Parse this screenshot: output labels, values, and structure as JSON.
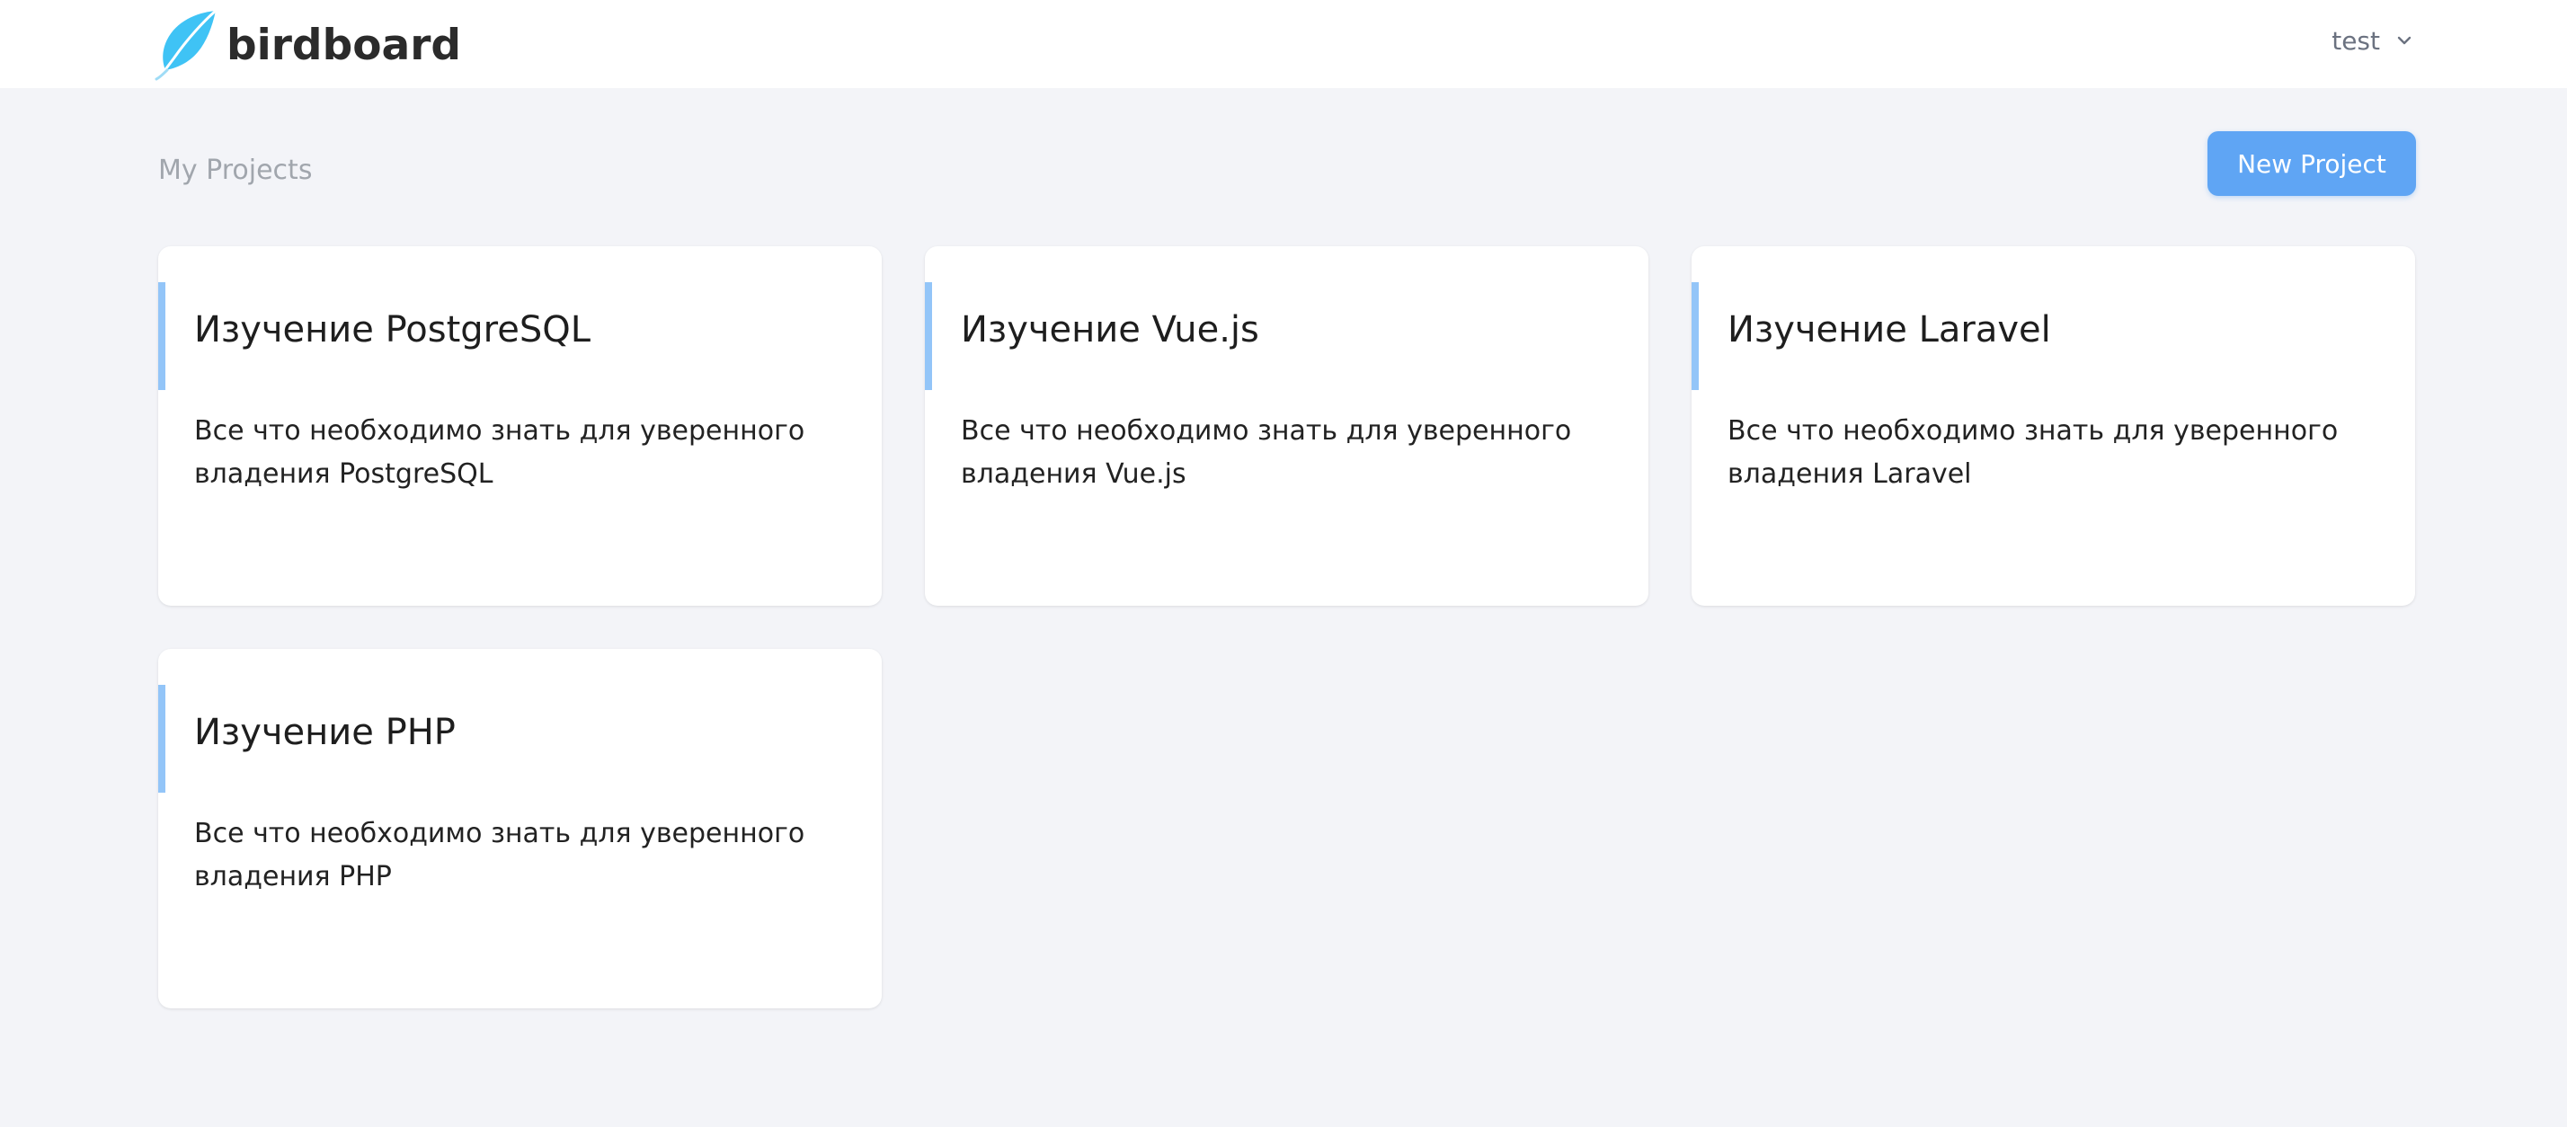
{
  "navbar": {
    "brand": "birdboard",
    "user": "test"
  },
  "header": {
    "title": "My Projects",
    "new_project_label": "New Project"
  },
  "projects": [
    {
      "title": "Изучение PostgreSQL",
      "description": "Все что необходимо знать для уверенного владения PostgreSQL"
    },
    {
      "title": "Изучение Vue.js",
      "description": "Все что необходимо знать для уверенного владения Vue.js"
    },
    {
      "title": "Изучение Laravel",
      "description": "Все что необходимо знать для уверенного владения Laravel"
    },
    {
      "title": "Изучение PHP",
      "description": "Все что необходимо знать для уверенного владения PHP"
    }
  ],
  "icons": {
    "logo": "feather-logo-icon",
    "user_menu": "chevron-down-icon"
  },
  "colors": {
    "accent": "#5fa5f4",
    "card_accent": "#93c5f8",
    "logo": "#3fc3f5",
    "background": "#f3f4f8"
  }
}
